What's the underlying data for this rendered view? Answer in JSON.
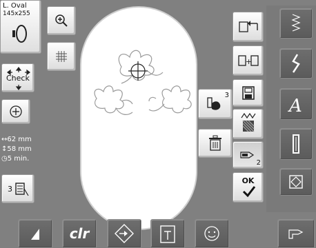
{
  "hoop": {
    "name": "L. Oval",
    "size": "145x255"
  },
  "check_label": "Check",
  "info": {
    "width": "↔62 mm",
    "height": "↕58 mm",
    "time": "◷5 min."
  },
  "color_count": "3",
  "color_button_badge": "3",
  "stitch_position_badge": "2",
  "ok_label": "OK",
  "bottom_bar": {
    "clr_label": "clr"
  }
}
